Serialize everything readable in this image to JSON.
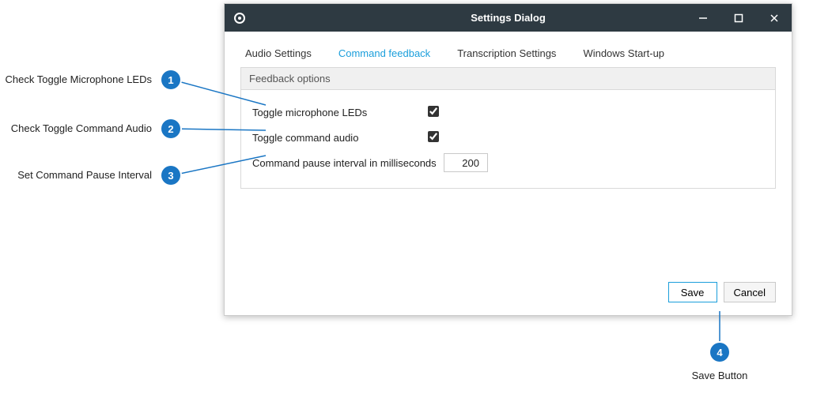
{
  "window": {
    "title": "Settings Dialog"
  },
  "tabs": [
    {
      "label": "Audio Settings",
      "active": false
    },
    {
      "label": "Command feedback",
      "active": true
    },
    {
      "label": "Transcription Settings",
      "active": false
    },
    {
      "label": "Windows Start-up",
      "active": false
    }
  ],
  "group": {
    "title": "Feedback options",
    "toggle_leds_label": "Toggle microphone LEDs",
    "toggle_leds_checked": true,
    "toggle_audio_label": "Toggle command audio",
    "toggle_audio_checked": true,
    "pause_interval_label": "Command pause interval in milliseconds",
    "pause_interval_value": "200"
  },
  "buttons": {
    "save": "Save",
    "cancel": "Cancel"
  },
  "callouts": [
    {
      "num": "1",
      "label": "Check Toggle Microphone LEDs"
    },
    {
      "num": "2",
      "label": "Check Toggle Command Audio"
    },
    {
      "num": "3",
      "label": "Set Command Pause Interval"
    },
    {
      "num": "4",
      "label": "Save Button"
    }
  ]
}
